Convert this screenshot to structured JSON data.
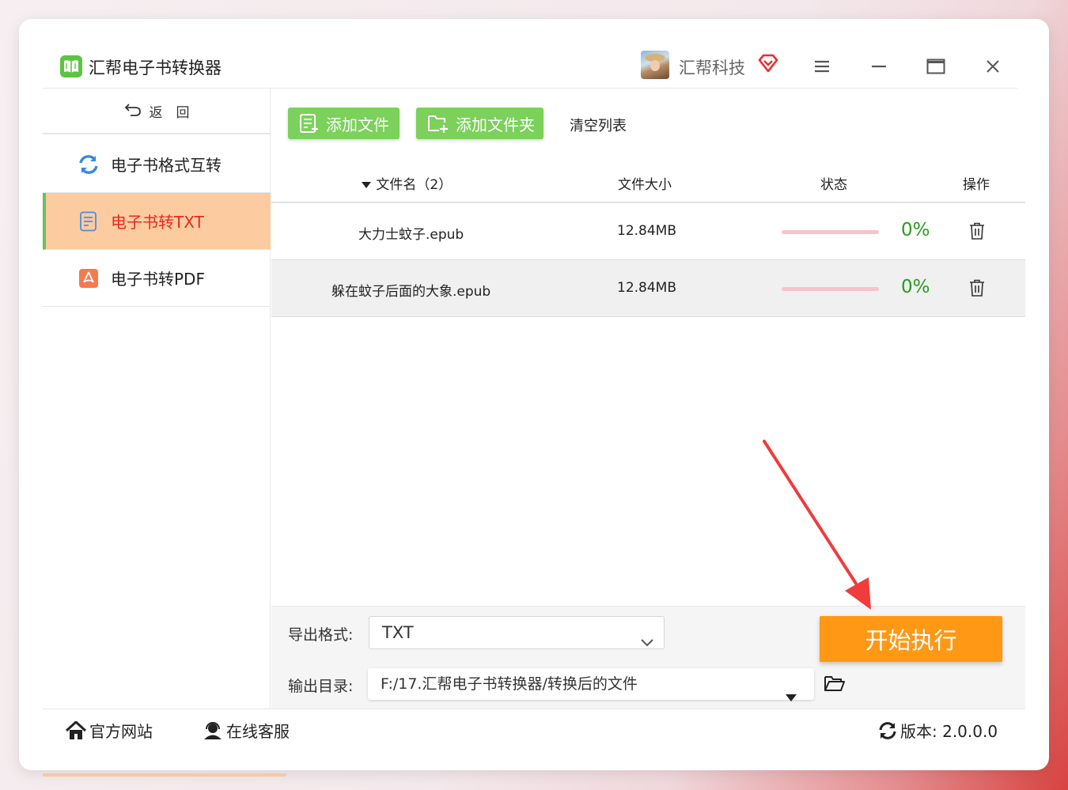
{
  "app": {
    "title": "汇帮电子书转换器",
    "brand_name": "汇帮科技"
  },
  "sidebar": {
    "back_label": "返　回",
    "items": [
      {
        "label": "电子书格式互转",
        "icon": "refresh-icon",
        "active": false
      },
      {
        "label": "电子书转TXT",
        "icon": "document-icon",
        "active": true
      },
      {
        "label": "电子书转PDF",
        "icon": "pdf-icon",
        "active": false
      }
    ]
  },
  "toolbar": {
    "add_file_label": "添加文件",
    "add_folder_label": "添加文件夹",
    "clear_label": "清空列表"
  },
  "table": {
    "headers": {
      "name": "文件名（2）",
      "size": "文件大小",
      "status": "状态",
      "action": "操作"
    },
    "rows": [
      {
        "name": "大力士蚊子.epub",
        "size": "12.84MB",
        "progress": 0,
        "progress_label": "0%"
      },
      {
        "name": "躲在蚊子后面的大象.epub",
        "size": "12.84MB",
        "progress": 0,
        "progress_label": "0%"
      }
    ]
  },
  "settings": {
    "format_label": "导出格式:",
    "format_value": "TXT",
    "dir_label": "输出目录:",
    "dir_value": "F:/17.汇帮电子书转换器/转换后的文件"
  },
  "start_label": "开始执行",
  "footer": {
    "website_label": "官方网站",
    "support_label": "在线客服",
    "version_label": "版本: 2.0.0.0"
  },
  "colors": {
    "accent_green": "#7bd15a",
    "start_orange": "#ff9814",
    "active_bg": "#fccba0",
    "active_text": "#e8281d",
    "percent_green": "#2a9a1f",
    "progress_track": "#f6c3cf",
    "annotation_arrow": "#f03c3c"
  }
}
